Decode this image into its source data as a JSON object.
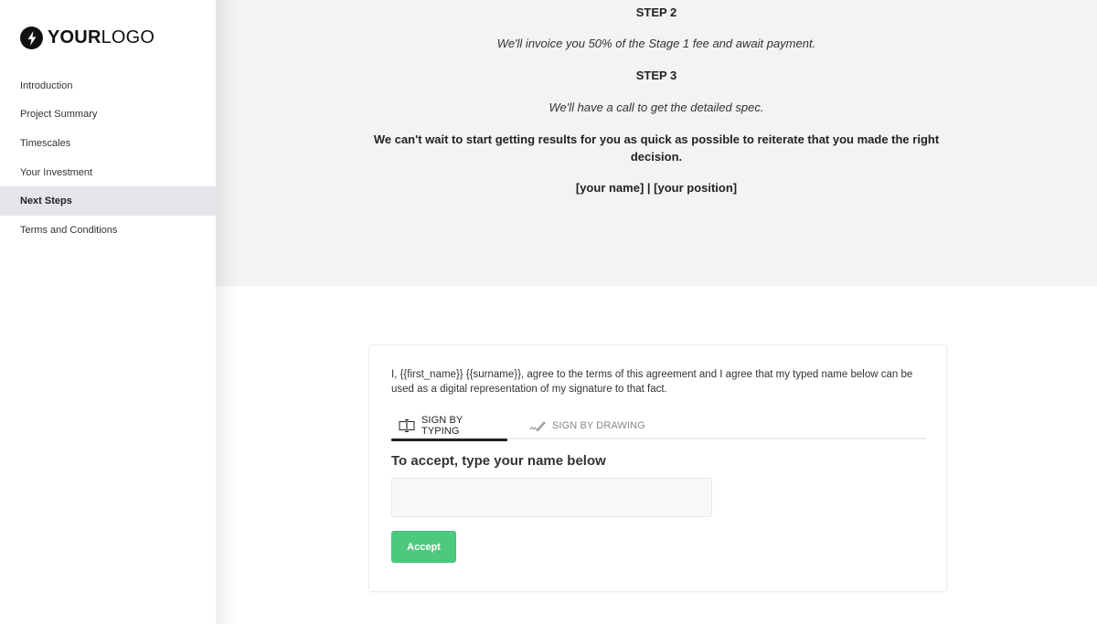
{
  "logo": {
    "icon": "lightning-bolt-icon",
    "bold": "YOUR",
    "light": "LOGO"
  },
  "sidebar": {
    "items": [
      {
        "label": "Introduction",
        "active": false
      },
      {
        "label": "Project Summary",
        "active": false
      },
      {
        "label": "Timescales",
        "active": false
      },
      {
        "label": "Your Investment",
        "active": false
      },
      {
        "label": "Next Steps",
        "active": true
      },
      {
        "label": "Terms and Conditions",
        "active": false
      }
    ]
  },
  "main": {
    "step2_heading": "STEP 2",
    "step2_text": "We'll invoice you 50% of the Stage 1 fee and await payment.",
    "step3_heading": "STEP 3",
    "step3_text": "We'll have a call to get the detailed spec.",
    "closing": "We can't wait to start getting results for you as quick as possible to reiterate that you made the right decision.",
    "signature": "[your name] | [your position]"
  },
  "signature_card": {
    "agreement": "I, {{first_name}} {{surname}}, agree to the terms of this agreement and I agree that my typed name below can be used as a digital representation of my signature to that fact.",
    "tabs": [
      {
        "label": "SIGN BY TYPING",
        "icon": "text-cursor-icon",
        "active": true
      },
      {
        "label": "SIGN BY DRAWING",
        "icon": "pen-icon",
        "active": false
      }
    ],
    "heading": "To accept, type your name below",
    "name_input": {
      "value": "",
      "placeholder": ""
    },
    "accept_label": "Accept",
    "accept_color": "#4cc97d"
  }
}
